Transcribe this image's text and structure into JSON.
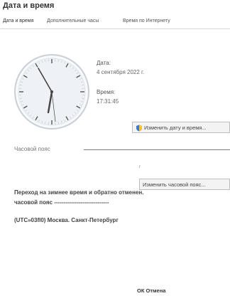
{
  "window": {
    "title": "Дата и время"
  },
  "tabs": [
    {
      "label": "Дата и время"
    },
    {
      "label": "Дополнительные часы"
    },
    {
      "label": "Время по Интернету"
    }
  ],
  "date": {
    "label": "Дата:",
    "value": "4 сентября 2022 г."
  },
  "time": {
    "label": "Время:",
    "value": "17:31:45"
  },
  "buttons": {
    "change_datetime": "Изменить дату и время...",
    "change_timezone": "Изменить часовой пояс..."
  },
  "timezone": {
    "section_label": "Часовой пояс",
    "small_mark": "г",
    "dst_notice": "Переход на зимнее время и обратно отменен.",
    "zone_label": "часовой пояс  -----------------------------",
    "zone_value": "(UTC»03fl0) Москва. Санкт-Петербург"
  },
  "footer": {
    "ok_cancel": "ОК Отмена"
  },
  "colors": {
    "clock_face": "#eef2f6",
    "clock_ring": "#b9c3cd",
    "second_hand": "#e14a4a",
    "icon_blue": "#3a78c9"
  }
}
